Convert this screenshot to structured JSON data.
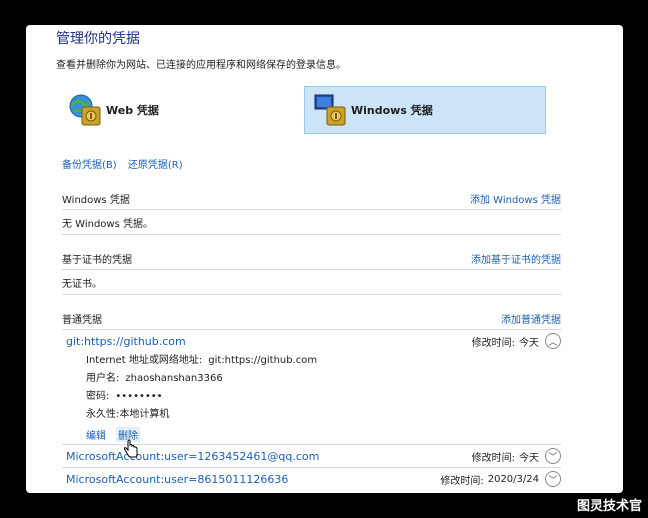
{
  "header": {
    "title": "管理你的凭据",
    "description": "查看并删除你为网站、已连接的应用程序和网络保存的登录信息。"
  },
  "tiles": {
    "web": "Web 凭据",
    "windows": "Windows 凭据"
  },
  "links": {
    "backup": "备份凭据(B)",
    "restore": "还原凭据(R)"
  },
  "windows_section": {
    "title": "Windows 凭据",
    "add": "添加 Windows 凭据",
    "empty": "无 Windows 凭据。"
  },
  "cert_section": {
    "title": "基于证书的凭据",
    "add": "添加基于证书的凭据",
    "empty": "无证书。"
  },
  "generic_section": {
    "title": "普通凭据",
    "add": "添加普通凭据",
    "entries": [
      {
        "name": "git:https://github.com",
        "modified_label": "修改时间:",
        "modified": "今天",
        "address_label": "Internet 地址或网络地址:",
        "address": "git:https://github.com",
        "user_label": "用户名:",
        "user": "zhaoshanshan3366",
        "password_label": "密码:",
        "password": "••••••••",
        "persist_label": "永久性:",
        "persist": "本地计算机",
        "edit": "编辑",
        "delete": "删除"
      },
      {
        "name": "MicrosoftAccount:user=1263452461@qq.com",
        "modified_label": "修改时间:",
        "modified": "今天"
      },
      {
        "name": "MicrosoftAccount:user=8615011126636",
        "modified_label": "修改时间:",
        "modified": "2020/3/24"
      }
    ]
  },
  "watermark": "图灵技术官"
}
